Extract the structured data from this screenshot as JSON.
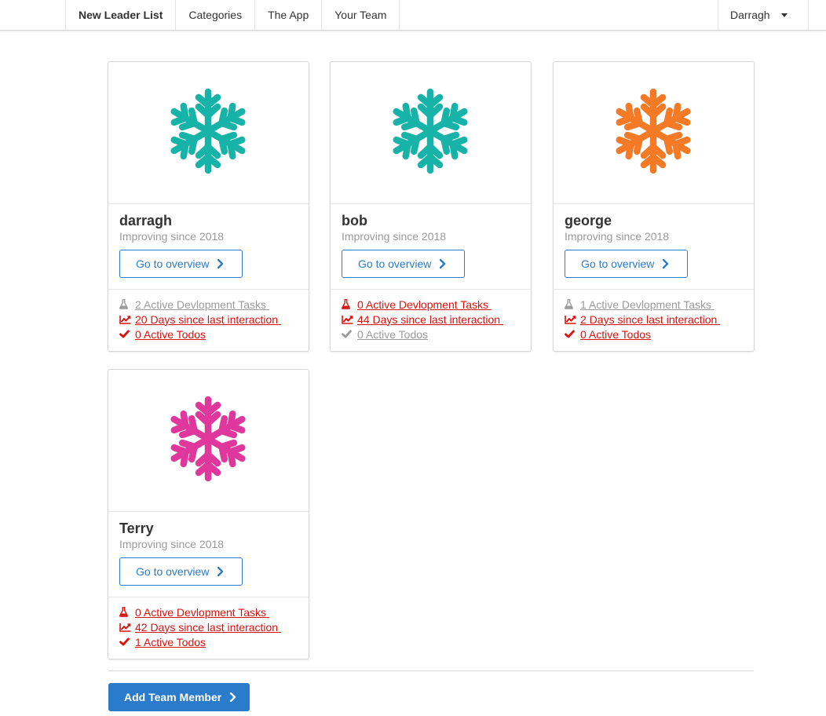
{
  "nav": {
    "items": [
      {
        "label": "New Leader List",
        "active": true
      },
      {
        "label": "Categories",
        "active": false
      },
      {
        "label": "The App",
        "active": false
      },
      {
        "label": "Your Team",
        "active": false
      }
    ],
    "user": "Darragh"
  },
  "cards": [
    {
      "name": "darragh",
      "subtitle": "Improving since 2018",
      "button": "Go to overview",
      "icon_color": "#17b3a8",
      "stats": [
        {
          "text": "2 Active Devlopment Tasks ",
          "icon": "flask-icon",
          "state": "muted"
        },
        {
          "text": "20 Days since last interaction ",
          "icon": "line-chart-icon",
          "state": "alert"
        },
        {
          "text": "0 Active Todos",
          "icon": "check-icon",
          "state": "alert"
        }
      ]
    },
    {
      "name": "bob",
      "subtitle": "Improving since 2018",
      "button": "Go to overview",
      "icon_color": "#17b3a8",
      "stats": [
        {
          "text": "0 Active Devlopment Tasks ",
          "icon": "flask-icon",
          "state": "alert"
        },
        {
          "text": "44 Days since last interaction ",
          "icon": "line-chart-icon",
          "state": "alert"
        },
        {
          "text": "0 Active Todos",
          "icon": "check-icon",
          "state": "muted"
        }
      ]
    },
    {
      "name": "george",
      "subtitle": "Improving since 2018",
      "button": "Go to overview",
      "icon_color": "#f47a26",
      "stats": [
        {
          "text": "1 Active Devlopment Tasks ",
          "icon": "flask-icon",
          "state": "muted"
        },
        {
          "text": "2 Days since last interaction ",
          "icon": "line-chart-icon",
          "state": "alert"
        },
        {
          "text": "0 Active Todos",
          "icon": "check-icon",
          "state": "alert"
        }
      ]
    },
    {
      "name": "Terry",
      "subtitle": "Improving since 2018",
      "button": "Go to overview",
      "icon_color": "#e0379d",
      "stats": [
        {
          "text": "0 Active Devlopment Tasks ",
          "icon": "flask-icon",
          "state": "alert"
        },
        {
          "text": "42 Days since last interaction ",
          "icon": "line-chart-icon",
          "state": "alert"
        },
        {
          "text": "1 Active Todos",
          "icon": "check-icon",
          "state": "alert"
        }
      ]
    }
  ],
  "colors": {
    "alert": "#d9130f",
    "muted": "#9a9a9a",
    "primary": "#2a7bc9"
  },
  "add_button": "Add Team Member"
}
